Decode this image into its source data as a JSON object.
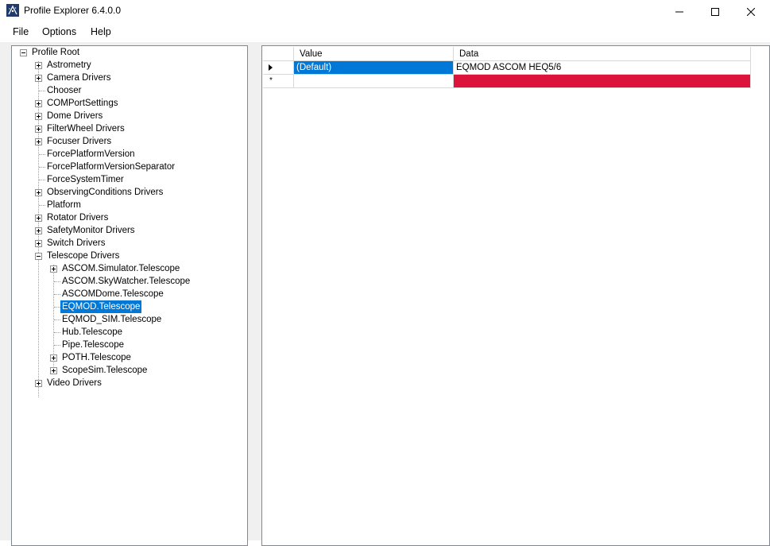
{
  "window": {
    "title": "Profile Explorer 6.4.0.0"
  },
  "menu": {
    "file": "File",
    "options": "Options",
    "help": "Help"
  },
  "tree": {
    "root": "Profile Root",
    "items": [
      "Astrometry",
      "Camera Drivers",
      "Chooser",
      "COMPortSettings",
      "Dome Drivers",
      "FilterWheel Drivers",
      "Focuser Drivers",
      "ForcePlatformVersion",
      "ForcePlatformVersionSeparator",
      "ForceSystemTimer",
      "ObservingConditions Drivers",
      "Platform",
      "Rotator Drivers",
      "SafetyMonitor Drivers",
      "Switch Drivers",
      "Telescope Drivers",
      "Video Drivers"
    ],
    "telescope_children": [
      "ASCOM.Simulator.Telescope",
      "ASCOM.SkyWatcher.Telescope",
      "ASCOMDome.Telescope",
      "EQMOD.Telescope",
      "EQMOD_SIM.Telescope",
      "Hub.Telescope",
      "Pipe.Telescope",
      "POTH.Telescope",
      "ScopeSim.Telescope"
    ],
    "selected": "EQMOD.Telescope"
  },
  "grid": {
    "columns": [
      "Value",
      "Data"
    ],
    "rows": [
      {
        "value": "(Default)",
        "data": "EQMOD ASCOM HEQ5/6"
      }
    ],
    "new_row_marker": "*"
  },
  "colors": {
    "selection": "#0078d7",
    "new_row_data": "#dc143c"
  }
}
